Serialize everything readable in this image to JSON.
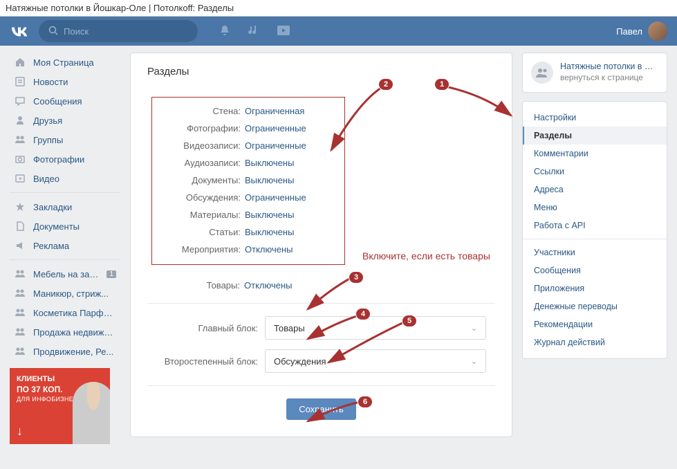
{
  "browser_title": "Натяжные потолки в Йошкар-Оле | Потолкоff: Разделы",
  "header": {
    "search_placeholder": "Поиск",
    "user_name": "Павел"
  },
  "leftnav": {
    "main": [
      {
        "label": "Моя Страница",
        "icon": "home"
      },
      {
        "label": "Новости",
        "icon": "news"
      },
      {
        "label": "Сообщения",
        "icon": "messages"
      },
      {
        "label": "Друзья",
        "icon": "friends"
      },
      {
        "label": "Группы",
        "icon": "groups"
      },
      {
        "label": "Фотографии",
        "icon": "photos"
      },
      {
        "label": "Видео",
        "icon": "video"
      }
    ],
    "second": [
      {
        "label": "Закладки",
        "icon": "bookmarks"
      },
      {
        "label": "Документы",
        "icon": "docs"
      },
      {
        "label": "Реклама",
        "icon": "ads"
      }
    ],
    "third": [
      {
        "label": "Мебель на зака...",
        "icon": "group",
        "badge": "1"
      },
      {
        "label": "Маникюр, стриж...",
        "icon": "group"
      },
      {
        "label": "Косметика Парфю...",
        "icon": "group"
      },
      {
        "label": "Продажа недвижи...",
        "icon": "group"
      },
      {
        "label": "Продвижение, Ре...",
        "icon": "group"
      }
    ]
  },
  "ad": {
    "line1": "КЛИЕНТЫ",
    "line2": "ПО 37 КОП.",
    "line3": "ДЛЯ ИНФОБИЗНЕСА"
  },
  "main": {
    "title": "Разделы",
    "settings": [
      {
        "k": "Стена:",
        "v": "Ограниченная"
      },
      {
        "k": "Фотографии:",
        "v": "Ограниченные"
      },
      {
        "k": "Видеозаписи:",
        "v": "Ограниченные"
      },
      {
        "k": "Аудиозаписи:",
        "v": "Выключены"
      },
      {
        "k": "Документы:",
        "v": "Выключены"
      },
      {
        "k": "Обсуждения:",
        "v": "Ограниченные"
      },
      {
        "k": "Материалы:",
        "v": "Выключены"
      },
      {
        "k": "Статьи:",
        "v": "Выключены"
      },
      {
        "k": "Мероприятия:",
        "v": "Отключены"
      }
    ],
    "tovary_k": "Товары:",
    "tovary_v": "Отключены",
    "block1_k": "Главный блок:",
    "block1_v": "Товары",
    "block2_k": "Второстепенный блок:",
    "block2_v": "Обсуждения",
    "save": "Сохранить"
  },
  "right": {
    "group_title": "Натяжные потолки в Йо...",
    "group_back": "вернуться к странице",
    "nav1": [
      {
        "label": "Настройки"
      },
      {
        "label": "Разделы",
        "active": true
      },
      {
        "label": "Комментарии"
      },
      {
        "label": "Ссылки"
      },
      {
        "label": "Адреса"
      },
      {
        "label": "Меню"
      },
      {
        "label": "Работа с API"
      }
    ],
    "nav2": [
      {
        "label": "Участники"
      },
      {
        "label": "Сообщения"
      },
      {
        "label": "Приложения"
      },
      {
        "label": "Денежные переводы"
      },
      {
        "label": "Рекомендации"
      },
      {
        "label": "Журнал действий"
      }
    ]
  },
  "annotations": {
    "note_text": "Включите, если есть товары",
    "badges": {
      "b1": "1",
      "b2": "2",
      "b3": "3",
      "b4": "4",
      "b5": "5",
      "b6": "6"
    }
  }
}
